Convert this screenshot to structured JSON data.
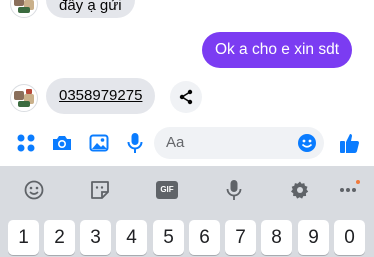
{
  "messages": {
    "incoming_top": "đây ạ gửi",
    "outgoing": "Ok a cho e xin sdt",
    "incoming_phone": "0358979275"
  },
  "composer": {
    "placeholder": "Aa"
  },
  "keyboard": {
    "gif_label": "GIF",
    "number_row": [
      "1",
      "2",
      "3",
      "4",
      "5",
      "6",
      "7",
      "8",
      "9",
      "0"
    ]
  },
  "colors": {
    "accent": "#7b3cf2",
    "messenger_blue": "#0a7cff",
    "incoming_bubble": "#e4e6eb"
  },
  "icons": {
    "composer": [
      "apps-icon",
      "camera-icon",
      "image-icon",
      "microphone-icon",
      "emoji-icon",
      "thumbs-up-icon"
    ],
    "keyboard_toolbar": [
      "emoji-icon",
      "sticker-icon",
      "gif-icon",
      "microphone-icon",
      "gear-icon",
      "more-icon"
    ]
  }
}
